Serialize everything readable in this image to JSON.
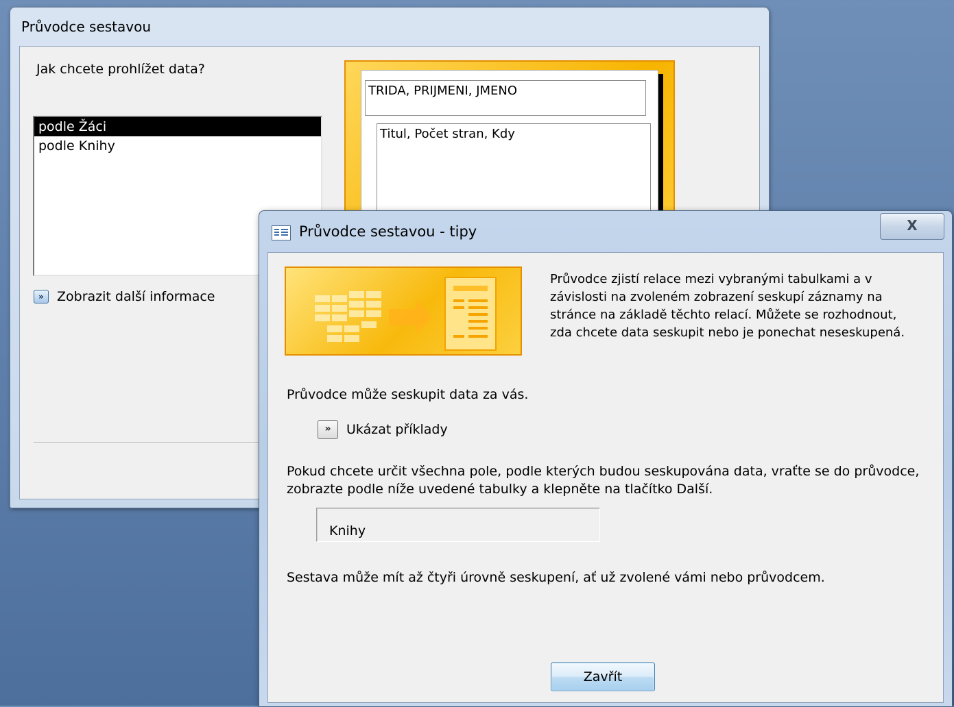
{
  "background_window": {
    "title": "Průvodce sestavou",
    "question": "Jak chcete prohlížet data?",
    "view_options": [
      {
        "label": "podle Žáci",
        "selected": true
      },
      {
        "label": "podle Knihy",
        "selected": false
      }
    ],
    "more_info_label": "Zobrazit další informace",
    "preview": {
      "group_fields": "TRIDA, PRIJMENI, JMENO",
      "detail_fields": "Titul, Počet stran, Kdy"
    }
  },
  "tips_dialog": {
    "title": "Průvodce sestavou - tipy",
    "close_glyph": "X",
    "description": "Průvodce zjistí relace mezi vybranými tabulkami a v závislosti na zvoleném zobrazení seskupí záznamy na stránce na základě těchto relací. Můžete se rozhodnout, zda chcete data seskupit nebo je ponechat neseskupená.",
    "text_grouping": "Průvodce může seskupit data za vás.",
    "examples_label": "Ukázat příklady",
    "text_fields": "Pokud chcete určit všechna pole, podle kterých budou seskupována data, vraťte se do průvodce, zobrazte podle níže uvedené tabulky a klepněte na tlačítko Další.",
    "table_name": "Knihy",
    "text_levels": "Sestava může mít až čtyři úrovně seskupení, ať už zvolené vámi nebo průvodcem.",
    "close_button": "Zavřít"
  },
  "colors": {
    "accent_orange": "#f7b400",
    "title_bar_blue": "#c4d6ec",
    "desktop": "#5d7ea9"
  },
  "icons": [
    "double-chevron-icon",
    "report-icon",
    "close-icon",
    "wizard-illustration-icon"
  ]
}
